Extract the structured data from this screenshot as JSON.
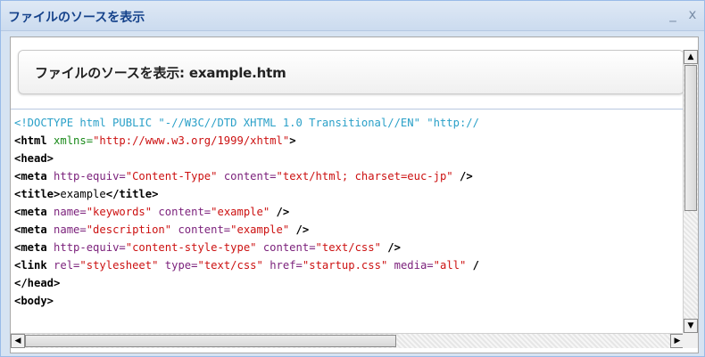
{
  "window": {
    "title": "ファイルのソースを表示",
    "minimize_label": "_",
    "close_label": "x"
  },
  "panel": {
    "header": "ファイルのソースを表示: example.htm"
  },
  "source_lines": [
    [
      {
        "t": "<!DOCTYPE html PUBLIC \"-//W3C//DTD XHTML 1.0 Transitional//EN\" \"http://",
        "c": "doctype"
      }
    ],
    [
      {
        "t": "<html ",
        "c": "tag"
      },
      {
        "t": "xmlns=",
        "c": "grn"
      },
      {
        "t": "\"http://www.w3.org/1999/xhtml\"",
        "c": "val"
      },
      {
        "t": ">",
        "c": "tag"
      }
    ],
    [
      {
        "t": "<head>",
        "c": "tag"
      }
    ],
    [
      {
        "t": "<meta ",
        "c": "tag"
      },
      {
        "t": "http-equiv=",
        "c": "attr"
      },
      {
        "t": "\"Content-Type\"",
        "c": "val"
      },
      {
        "t": " content=",
        "c": "attr"
      },
      {
        "t": "\"text/html; charset=euc-jp\"",
        "c": "val"
      },
      {
        "t": " />",
        "c": "tag"
      }
    ],
    [
      {
        "t": "<title>",
        "c": "tag"
      },
      {
        "t": "example",
        "c": "plain"
      },
      {
        "t": "</title>",
        "c": "tag"
      }
    ],
    [
      {
        "t": "<meta ",
        "c": "tag"
      },
      {
        "t": "name=",
        "c": "attr"
      },
      {
        "t": "\"keywords\"",
        "c": "val"
      },
      {
        "t": " content=",
        "c": "attr"
      },
      {
        "t": "\"example\"",
        "c": "val"
      },
      {
        "t": " />",
        "c": "tag"
      }
    ],
    [
      {
        "t": "<meta ",
        "c": "tag"
      },
      {
        "t": "name=",
        "c": "attr"
      },
      {
        "t": "\"description\"",
        "c": "val"
      },
      {
        "t": " content=",
        "c": "attr"
      },
      {
        "t": "\"example\"",
        "c": "val"
      },
      {
        "t": " />",
        "c": "tag"
      }
    ],
    [
      {
        "t": "<meta ",
        "c": "tag"
      },
      {
        "t": "http-equiv=",
        "c": "attr"
      },
      {
        "t": "\"content-style-type\"",
        "c": "val"
      },
      {
        "t": " content=",
        "c": "attr"
      },
      {
        "t": "\"text/css\"",
        "c": "val"
      },
      {
        "t": " />",
        "c": "tag"
      }
    ],
    [
      {
        "t": "<link ",
        "c": "tag"
      },
      {
        "t": "rel=",
        "c": "attr"
      },
      {
        "t": "\"stylesheet\"",
        "c": "val"
      },
      {
        "t": " type=",
        "c": "attr"
      },
      {
        "t": "\"text/css\"",
        "c": "val"
      },
      {
        "t": " href=",
        "c": "attr"
      },
      {
        "t": "\"startup.css\"",
        "c": "val"
      },
      {
        "t": " media=",
        "c": "attr"
      },
      {
        "t": "\"all\"",
        "c": "val"
      },
      {
        "t": " /",
        "c": "tag"
      }
    ],
    [
      {
        "t": "</head>",
        "c": "tag"
      }
    ],
    [
      {
        "t": "<body>",
        "c": "tag"
      }
    ]
  ],
  "scrollbars": {
    "up_arrow": "▲",
    "down_arrow": "▼",
    "left_arrow": "◀",
    "right_arrow": "▶"
  },
  "colors": {
    "titlebar_text": "#15428b",
    "doctype": "#2aa0c8",
    "attribute": "#7a1f7a",
    "value": "#cc1111",
    "namespace": "#1a8a1a"
  }
}
